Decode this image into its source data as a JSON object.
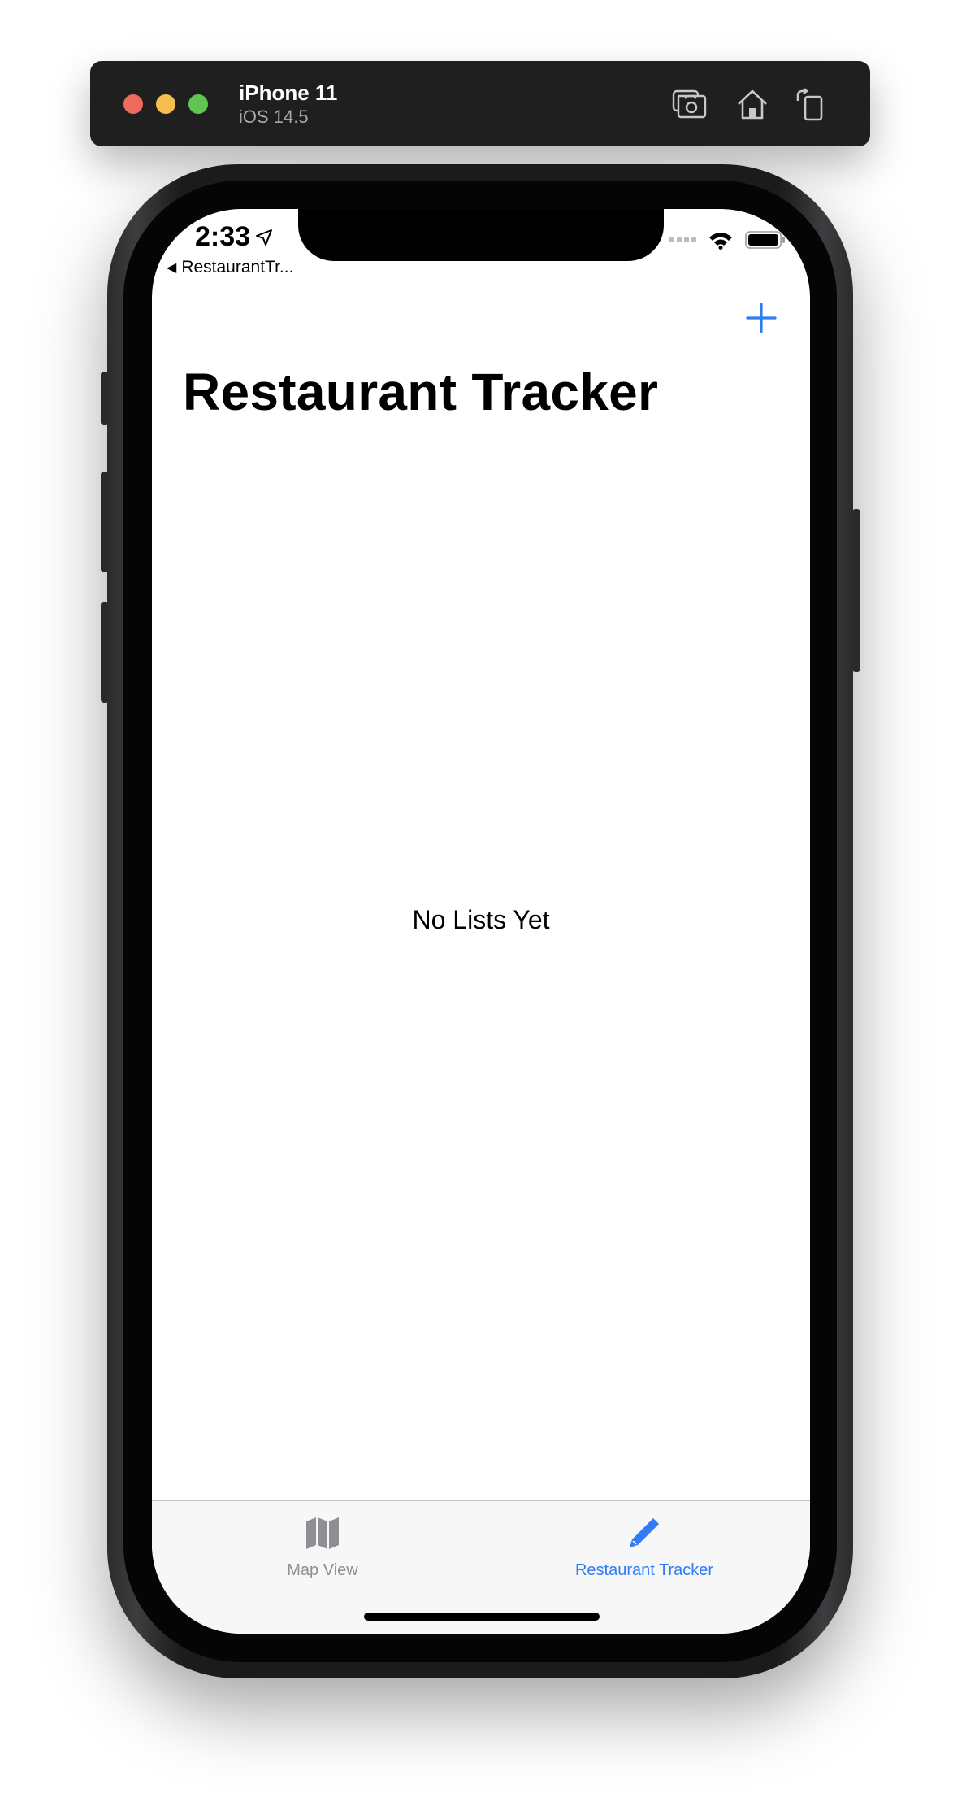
{
  "simulator": {
    "device_name": "iPhone 11",
    "os_version": "iOS 14.5",
    "toolbar_icons": [
      "screenshot-icon",
      "home-icon",
      "rotate-icon"
    ]
  },
  "status_bar": {
    "time": "2:33",
    "icons": [
      "location-arrow-icon",
      "cellular-signal-icon",
      "wifi-icon",
      "battery-icon"
    ]
  },
  "nav": {
    "back_label": "RestaurantTr...",
    "title": "Restaurant Tracker",
    "add_icon": "plus-icon"
  },
  "content": {
    "empty_message": "No Lists Yet"
  },
  "tab_bar": {
    "tabs": [
      {
        "label": "Map View",
        "icon": "map-icon",
        "selected": false
      },
      {
        "label": "Restaurant Tracker",
        "icon": "pencil-icon",
        "selected": true
      }
    ]
  },
  "colors": {
    "accent": "#2f7cf6",
    "inactive": "#8e8e93",
    "window_chrome": "#1f1f1f"
  }
}
